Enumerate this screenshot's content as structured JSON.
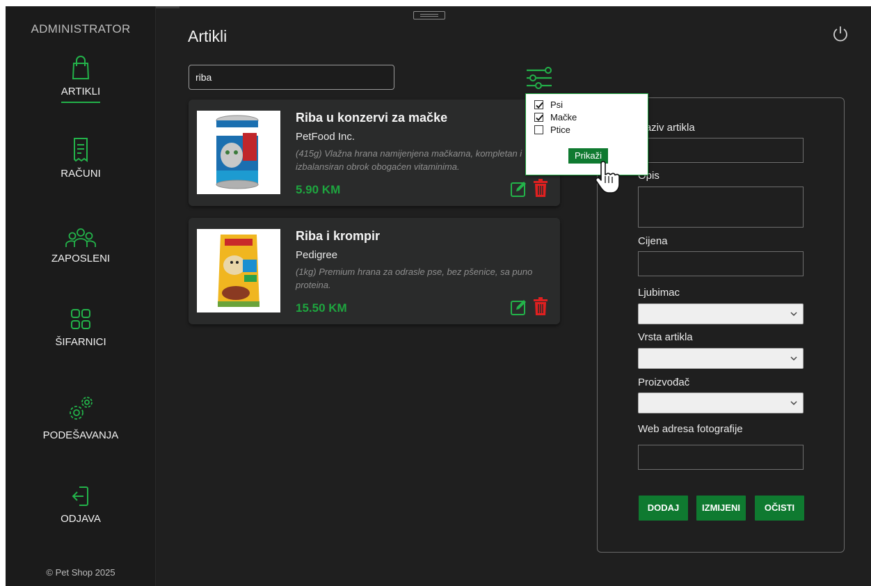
{
  "app": {
    "brand": "ADMINISTRATOR",
    "copyright": "© Pet Shop 2025",
    "accent": "#23b34a",
    "button_color": "#0f7a30",
    "price_color": "#1ea53f",
    "delete_color": "#e02020"
  },
  "sidebar": {
    "items": [
      {
        "label": "ARTIKLI",
        "icon": "shopping-bag-icon",
        "active": true
      },
      {
        "label": "RAČUNI",
        "icon": "receipt-icon",
        "active": false
      },
      {
        "label": "ZAPOSLENI",
        "icon": "users-icon",
        "active": false
      },
      {
        "label": "ŠIFARNICI",
        "icon": "grid-icon",
        "active": false
      },
      {
        "label": "PODEŠAVANJA",
        "icon": "gears-icon",
        "active": false
      },
      {
        "label": "ODJAVA",
        "icon": "logout-icon",
        "active": false
      }
    ]
  },
  "header": {
    "title": "Artikli",
    "search_value": "riba"
  },
  "products": [
    {
      "name": "Riba u konzervi za mačke",
      "brand": "PetFood Inc.",
      "description": "(415g) Vlažna hrana namijenjena mačkama, kompletan i izbalansiran obrok obogaćen vitaminima.",
      "price": "5.90 KM",
      "image": "cat-food-can"
    },
    {
      "name": "Riba i krompir",
      "brand": "Pedigree",
      "description": "(1kg) Premium hrana za odrasle pse, bez pšenice, sa puno proteina.",
      "price": "15.50 KM",
      "image": "dog-food-bag"
    }
  ],
  "filter_popup": {
    "options": [
      {
        "label": "Psi",
        "checked": true
      },
      {
        "label": "Mačke",
        "checked": true
      },
      {
        "label": "Ptice",
        "checked": false
      }
    ],
    "button": "Prikaži"
  },
  "form": {
    "naziv_label": "Naziv artikla",
    "opis_label": "Opis",
    "cijena_label": "Cijena",
    "ljubimac_label": "Ljubimac",
    "vrsta_label": "Vrsta artikla",
    "proizvodac_label": "Proizvođač",
    "web_label": "Web adresa fotografije",
    "add_button": "DODAJ",
    "edit_button": "IZMIJENI",
    "clear_button": "OČISTI"
  }
}
